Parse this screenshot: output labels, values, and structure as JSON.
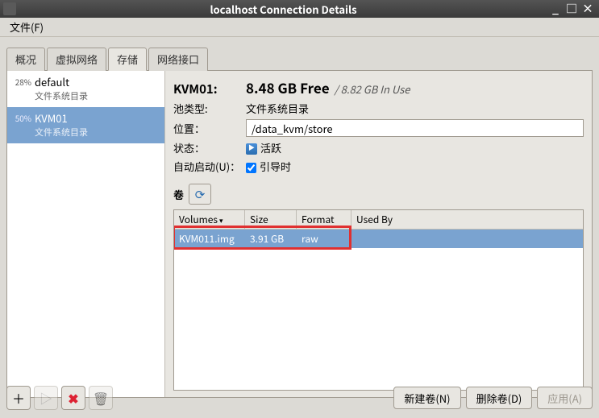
{
  "window": {
    "title": "localhost Connection Details",
    "min": "_",
    "max": "□",
    "close": "×"
  },
  "menu": {
    "file": "文件(F)"
  },
  "tabs": {
    "overview": "概况",
    "vnet": "虚拟网络",
    "storage": "存储",
    "netif": "网络接口"
  },
  "pools": [
    {
      "pct": "28%",
      "name": "default",
      "type": "文件系统目录"
    },
    {
      "pct": "50%",
      "name": "KVM01",
      "type": "文件系统目录"
    }
  ],
  "detail": {
    "name_label": "KVM01:",
    "free": "8.48 GB Free",
    "inuse": "/ 8.82 GB In Use",
    "pooltype_label": "池类型:",
    "pooltype_value": "文件系统目录",
    "location_label": "位置：",
    "location_value": "/data_kvm/store",
    "state_label": "状态：",
    "state_value": "活跃",
    "autostart_label": "自动启动(U)：",
    "autostart_value": "引导时",
    "volumes_label": "卷"
  },
  "table": {
    "headers": {
      "volumes": "Volumes",
      "size": "Size",
      "format": "Format",
      "usedby": "Used By"
    },
    "rows": [
      {
        "name": "KVM011.img",
        "size": "3.91 GB",
        "format": "raw",
        "usedby": ""
      }
    ]
  },
  "footer": {
    "newvol": "新建卷(N)",
    "delvol": "删除卷(D)",
    "apply": "应用(A)"
  }
}
